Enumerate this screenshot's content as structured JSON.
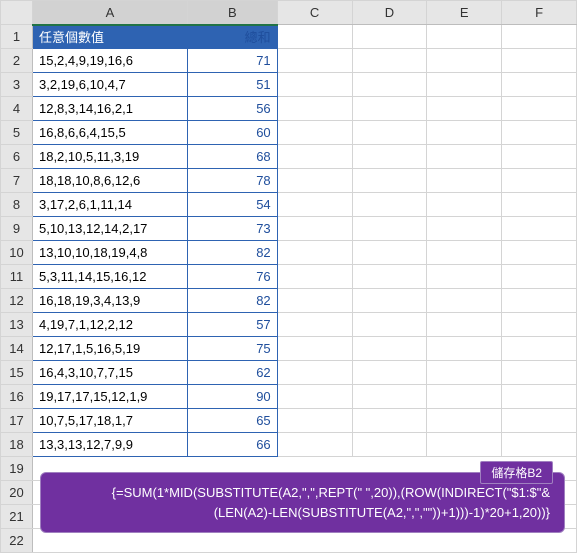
{
  "columns": [
    "A",
    "B",
    "C",
    "D",
    "E",
    "F"
  ],
  "header": {
    "a": "任意個數值",
    "b": "總和"
  },
  "rows": [
    {
      "a": "15,2,4,9,19,16,6",
      "b": "71"
    },
    {
      "a": "3,2,19,6,10,4,7",
      "b": "51"
    },
    {
      "a": "12,8,3,14,16,2,1",
      "b": "56"
    },
    {
      "a": "16,8,6,6,4,15,5",
      "b": "60"
    },
    {
      "a": "18,2,10,5,11,3,19",
      "b": "68"
    },
    {
      "a": "18,18,10,8,6,12,6",
      "b": "78"
    },
    {
      "a": "3,17,2,6,1,11,14",
      "b": "54"
    },
    {
      "a": "5,10,13,12,14,2,17",
      "b": "73"
    },
    {
      "a": "13,10,10,18,19,4,8",
      "b": "82"
    },
    {
      "a": "5,3,11,14,15,16,12",
      "b": "76"
    },
    {
      "a": "16,18,19,3,4,13,9",
      "b": "82"
    },
    {
      "a": "4,19,7,1,12,2,12",
      "b": "57"
    },
    {
      "a": "12,17,1,5,16,5,19",
      "b": "75"
    },
    {
      "a": "16,4,3,10,7,7,15",
      "b": "62"
    },
    {
      "a": "19,17,17,15,12,1,9",
      "b": "90"
    },
    {
      "a": "10,7,5,17,18,1,7",
      "b": "65"
    },
    {
      "a": "13,3,13,12,7,9,9",
      "b": "66"
    }
  ],
  "tooltip": {
    "badge": "儲存格B2",
    "line1": "{=SUM(1*MID(SUBSTITUTE(A2,\",\",REPT(\" \",20)),(ROW(INDIRECT(\"$1:$\"&",
    "line2": "(LEN(A2)-LEN(SUBSTITUTE(A2,\",\",\"\"))+1)))-1)*20+1,20))}"
  }
}
